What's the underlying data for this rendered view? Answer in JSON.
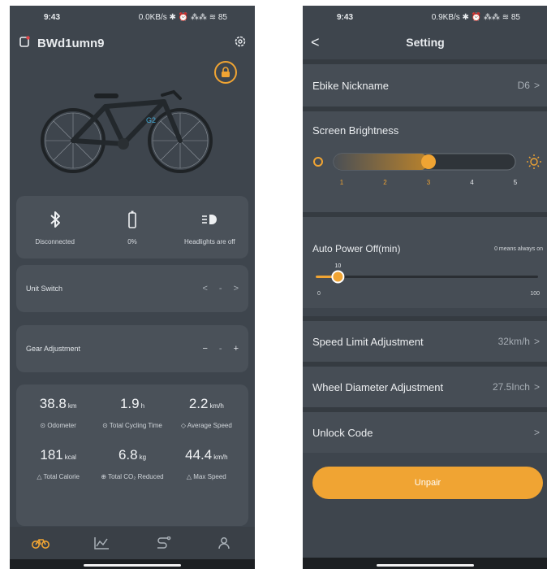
{
  "left": {
    "status_bar": {
      "time": "9:43",
      "indicators": "0.0KB/s ✱ ⏰ ⁂⁂ ≋ 85"
    },
    "header": {
      "device_name": "BWd1umn9"
    },
    "status": {
      "bluetooth_label": "Disconnected",
      "battery_label": "0%",
      "headlight_label": "Headlights are off"
    },
    "unit_switch": {
      "label": "Unit Switch",
      "prev": "<",
      "mid": "-",
      "next": ">"
    },
    "gear_adjustment": {
      "label": "Gear Adjustment",
      "minus": "−",
      "mid": "-",
      "plus": "+"
    },
    "stats": [
      {
        "value": "38.8",
        "unit": "km",
        "caption": "⊙ Odometer"
      },
      {
        "value": "1.9",
        "unit": "h",
        "caption": "⊙ Total Cycling Time"
      },
      {
        "value": "2.2",
        "unit": "km/h",
        "caption": "◇ Average Speed"
      },
      {
        "value": "181",
        "unit": "kcal",
        "caption": "△ Total Calorie"
      },
      {
        "value": "6.8",
        "unit": "kg",
        "caption": "⊕ Total CO₂ Reduced"
      },
      {
        "value": "44.4",
        "unit": "km/h",
        "caption": "△ Max Speed"
      }
    ],
    "colors": {
      "accent": "#f0a433",
      "background": "#3e454d",
      "card": "#4a5159"
    }
  },
  "right": {
    "status_bar": {
      "time": "9:43",
      "indicators": "0.9KB/s ✱ ⏰ ⁂⁂ ≋ 85"
    },
    "nav": {
      "back": "<",
      "title": "Setting"
    },
    "nickname": {
      "label": "Ebike Nickname",
      "value": "D6",
      "chevron": ">"
    },
    "brightness": {
      "label": "Screen Brightness",
      "ticks": [
        "1",
        "2",
        "3",
        "4",
        "5"
      ],
      "selected": 3
    },
    "auto_power_off": {
      "label": "Auto Power Off(min)",
      "hint": "0 means always on",
      "value": "10",
      "min": "0",
      "max": "100",
      "level": 0.1
    },
    "speed_limit": {
      "label": "Speed Limit Adjustment",
      "value": "32km/h",
      "chevron": ">"
    },
    "wheel_diameter": {
      "label": "Wheel Diameter Adjustment",
      "value": "27.5Inch",
      "chevron": ">"
    },
    "unlock_code": {
      "label": "Unlock Code",
      "chevron": ">"
    },
    "unpair_label": "Unpair",
    "colors": {
      "accent": "#f0a433",
      "background": "#3e454d"
    }
  }
}
